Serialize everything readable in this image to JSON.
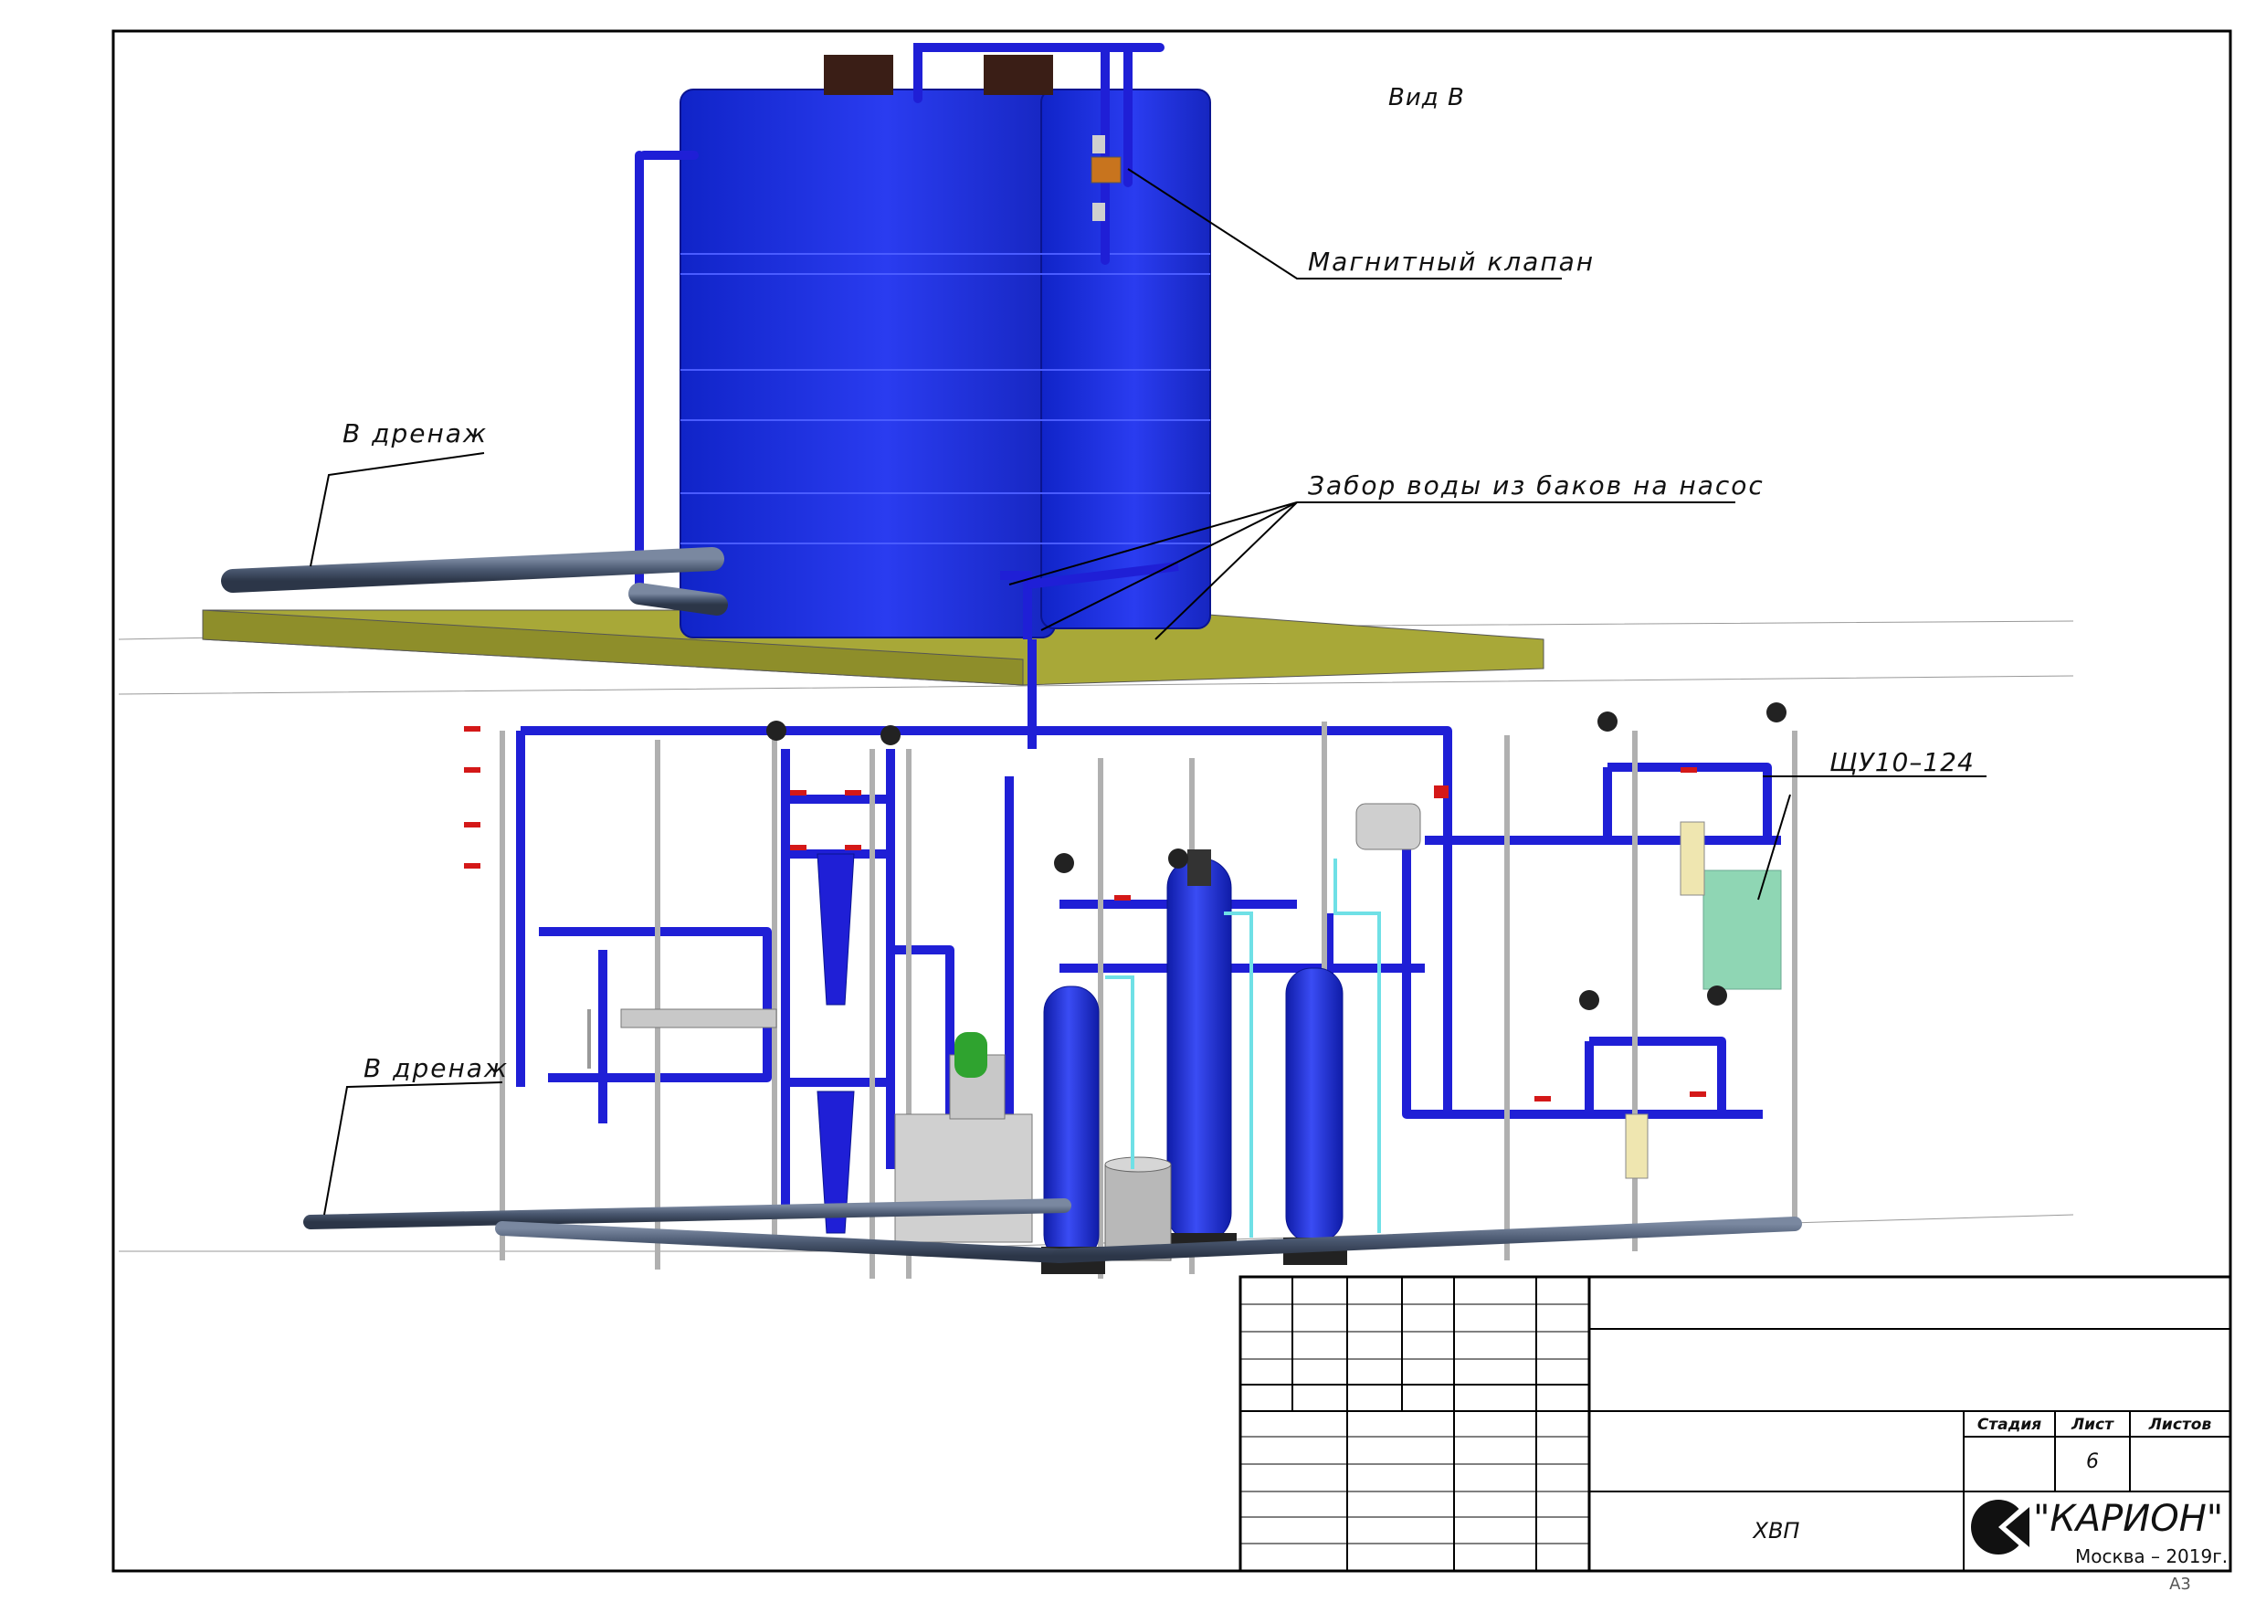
{
  "view_title": "Вид В",
  "callouts": {
    "magnetic_valve": "Магнитный клапан",
    "drain_top": "В дренаж",
    "water_intake": "Забор воды из баков на насос",
    "control_panel": "ЩУ10–124",
    "drain_bottom": "В дренаж"
  },
  "title_block": {
    "stage_header": "Стадия",
    "sheet_header": "Лист",
    "sheets_header": "Листов",
    "sheet_value": "6",
    "drawing_name": "ХВП",
    "company": "\"КАРИОН\"",
    "city_year": "Москва – 2019г.",
    "format": "А3"
  },
  "colors": {
    "pipe_blue": "#1f1fd6",
    "tank_blue": "#1a2ee0",
    "drain_pipe": "#4a5870",
    "platform": "#a0a033",
    "panel_green": "#8fd6b4",
    "cyan_tube": "#6fe0e6"
  }
}
